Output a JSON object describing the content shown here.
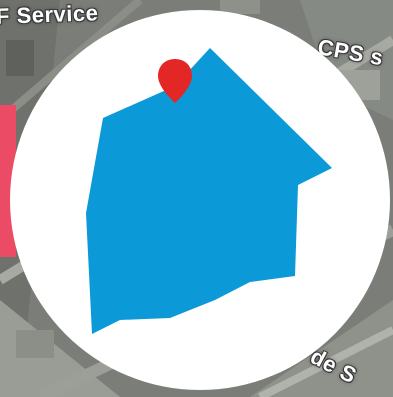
{
  "map": {
    "type": "satellite",
    "labels": {
      "top_left": "F Service",
      "top_right": "CPS s",
      "bottom_right": "de S"
    }
  },
  "colors": {
    "area_fill": "#0c99d8",
    "circle_fill": "#ffffff",
    "pin_color": "#e32626",
    "side_marker": "#ec4b66"
  },
  "icons": {
    "pin": "map-pin-icon",
    "area": "boundary-polygon"
  }
}
